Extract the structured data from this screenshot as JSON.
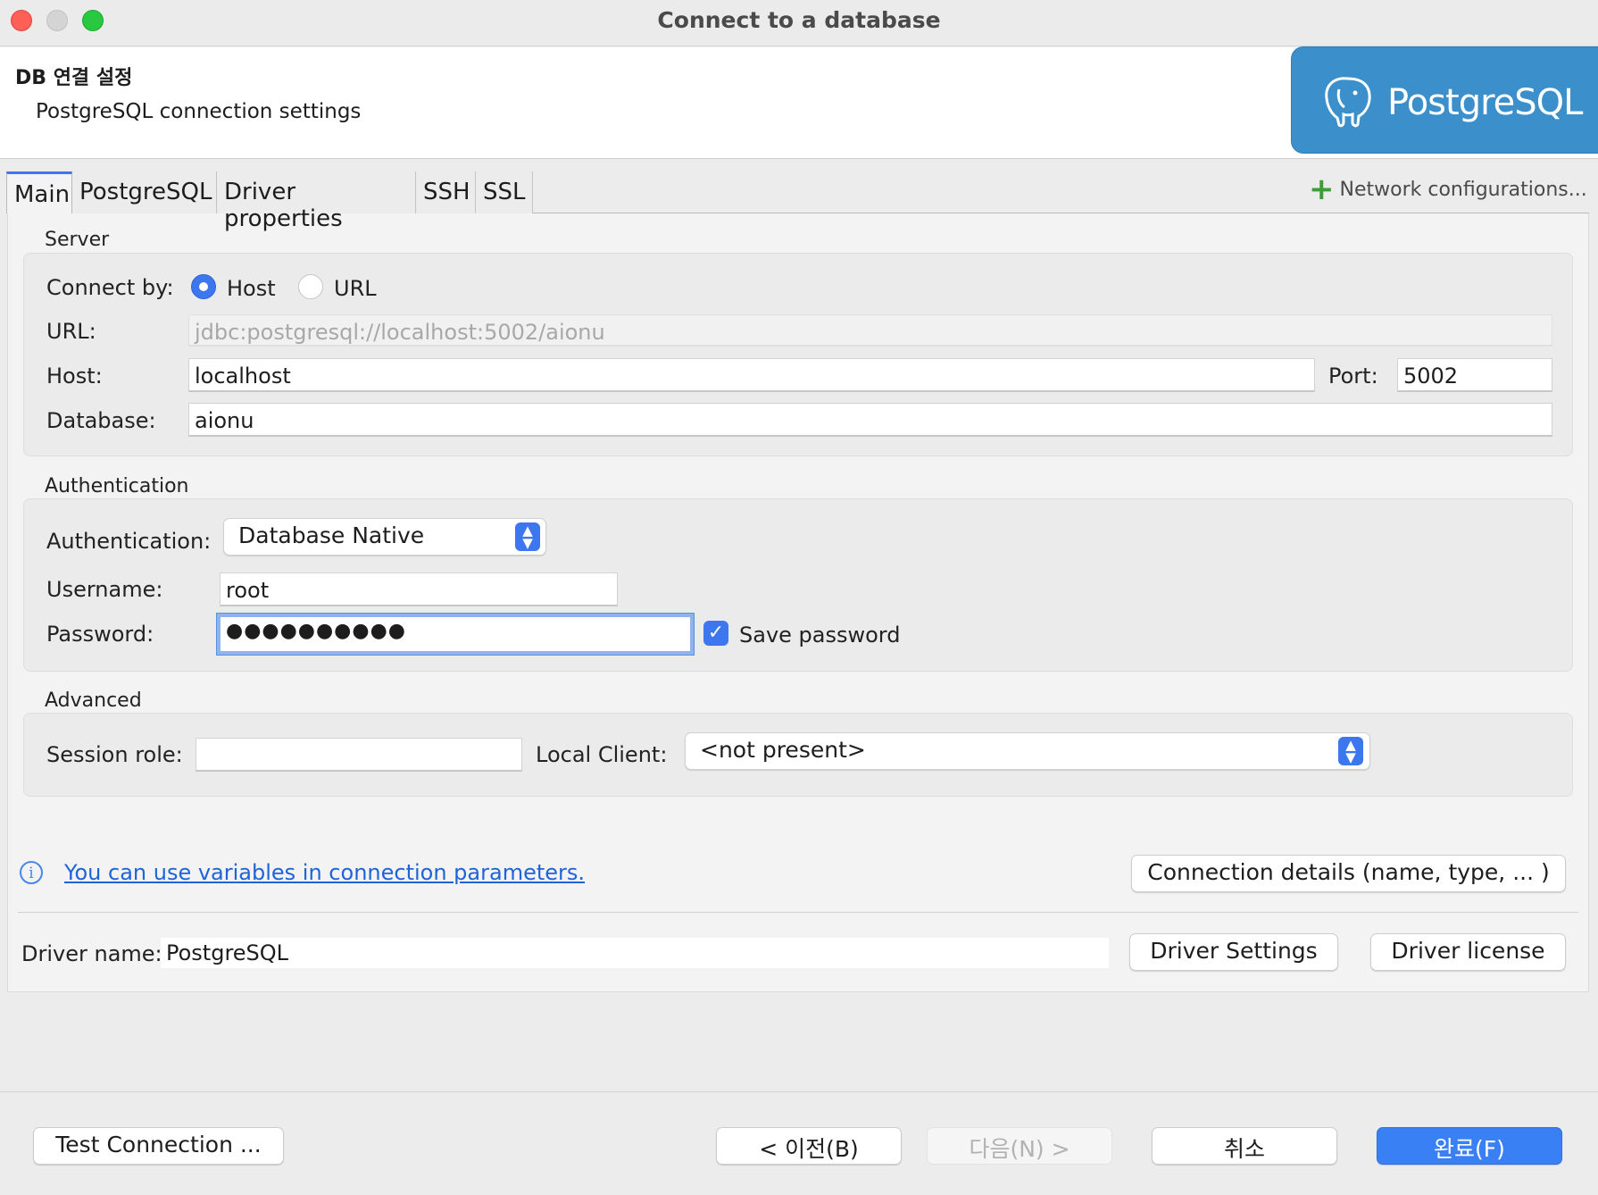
{
  "window": {
    "title": "Connect to a database"
  },
  "header": {
    "title": "DB 연결 설정",
    "subtitle": "PostgreSQL connection settings",
    "logo_text": "PostgreSQL"
  },
  "tabs": [
    {
      "label": "Main",
      "active": true
    },
    {
      "label": "PostgreSQL"
    },
    {
      "label": "Driver properties"
    },
    {
      "label": "SSH"
    },
    {
      "label": "SSL"
    }
  ],
  "network_config": {
    "label": "Network configurations..."
  },
  "server": {
    "group_label": "Server",
    "connect_by_label": "Connect by:",
    "option_host": "Host",
    "option_url": "URL",
    "selected": "Host",
    "url_label": "URL:",
    "url_value": "jdbc:postgresql://localhost:5002/aionu",
    "host_label": "Host:",
    "host_value": "localhost",
    "port_label": "Port:",
    "port_value": "5002",
    "database_label": "Database:",
    "database_value": "aionu"
  },
  "authentication": {
    "group_label": "Authentication",
    "auth_label": "Authentication:",
    "auth_value": "Database Native",
    "username_label": "Username:",
    "username_value": "root",
    "password_label": "Password:",
    "password_value": "●●●●●●●●●●",
    "save_password_label": "Save password",
    "save_password_checked": true
  },
  "advanced": {
    "group_label": "Advanced",
    "session_role_label": "Session role:",
    "session_role_value": "",
    "local_client_label": "Local Client:",
    "local_client_value": "<not present>"
  },
  "info_link": "You can use variables in connection parameters.",
  "connection_details_button": "Connection details (name, type, ... )",
  "driver": {
    "name_label": "Driver name:",
    "name_value": "PostgreSQL",
    "settings_button": "Driver Settings",
    "license_button": "Driver license"
  },
  "footer": {
    "test_button": "Test Connection ...",
    "back_button": "< 이전(B)",
    "next_button": "다음(N) >",
    "cancel_button": "취소",
    "finish_button": "완료(F)"
  },
  "colors": {
    "accent": "#3c77f0",
    "logo_bg": "#3b8fcb",
    "link": "#1f63d9",
    "add_green": "#3aa036"
  }
}
